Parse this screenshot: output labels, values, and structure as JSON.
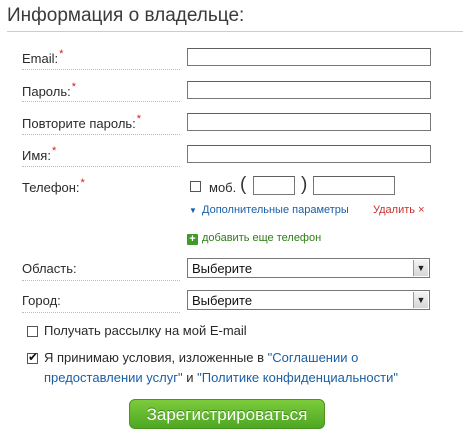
{
  "form": {
    "title": "Информация о владельце:",
    "required_mark": "*",
    "fields": {
      "email_label": "Email:",
      "password_label": "Пароль:",
      "password_repeat_label": "Повторите пароль:",
      "name_label": "Имя:",
      "phone_label": "Телефон:"
    },
    "phone": {
      "mobile_label": "моб.",
      "open_paren": "(",
      "close_paren": ")",
      "extra_params_link": "Дополнительные параметры",
      "delete_link": "Удалить",
      "delete_mark": "×",
      "add_phone_link": "добавить еще телефон"
    },
    "region": {
      "label": "Область:",
      "selected": "Выберите"
    },
    "city": {
      "label": "Город:",
      "selected": "Выберите"
    },
    "newsletter": {
      "label": "Получать рассылку на мой E-mail",
      "checked": false
    },
    "terms": {
      "checked": true,
      "prefix": "Я принимаю условия, изложенные в ",
      "agreement_link": "\"Соглашении о предоставлении услуг\"",
      "middle": " и ",
      "privacy_link": "\"Политике конфиденциальности\""
    },
    "submit_label": "Зарегистрироваться"
  },
  "colors": {
    "link": "#1a5fa6",
    "required": "#d02020",
    "accent_green": "#4ea722"
  },
  "icons": [
    "arrow-down-icon",
    "close-icon",
    "plus-icon",
    "checkbox-icon"
  ]
}
